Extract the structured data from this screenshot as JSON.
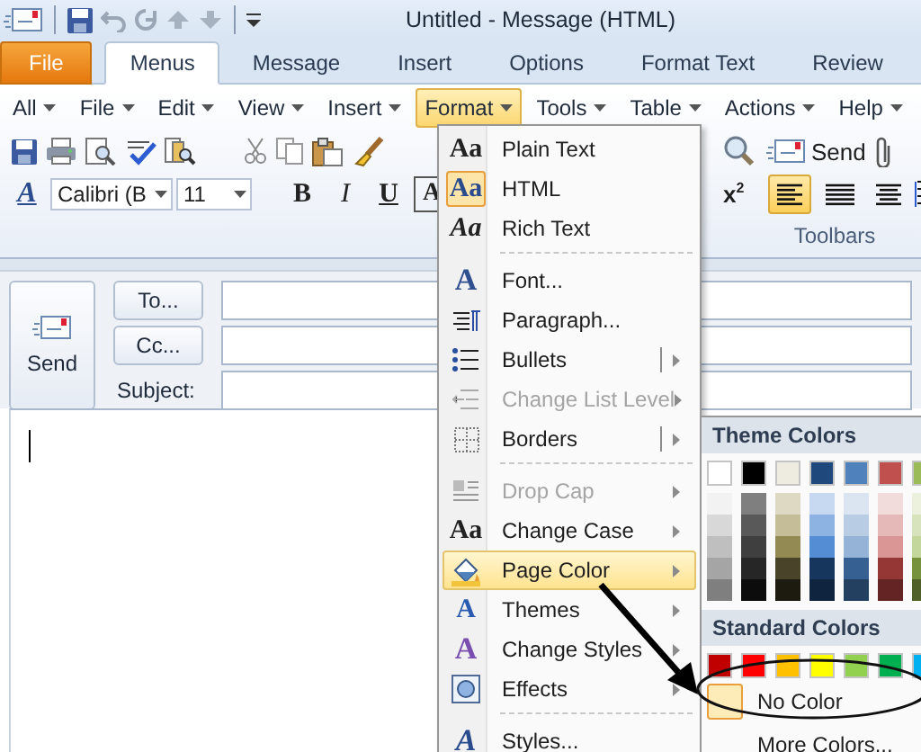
{
  "window": {
    "title": "Untitled - Message (HTML)"
  },
  "ribbon_tabs": [
    {
      "label": "File",
      "kind": "file",
      "selected": false
    },
    {
      "label": "Menus",
      "kind": "tab",
      "selected": true
    },
    {
      "label": "Message",
      "kind": "tab",
      "selected": false
    },
    {
      "label": "Insert",
      "kind": "tab",
      "selected": false
    },
    {
      "label": "Options",
      "kind": "tab",
      "selected": false
    },
    {
      "label": "Format Text",
      "kind": "tab",
      "selected": false
    },
    {
      "label": "Review",
      "kind": "tab",
      "selected": false
    }
  ],
  "menu_bar": [
    {
      "label": "All",
      "selected": false
    },
    {
      "label": "File",
      "selected": false
    },
    {
      "label": "Edit",
      "selected": false
    },
    {
      "label": "View",
      "selected": false
    },
    {
      "label": "Insert",
      "selected": false
    },
    {
      "label": "Format",
      "selected": true
    },
    {
      "label": "Tools",
      "selected": false
    },
    {
      "label": "Table",
      "selected": false
    },
    {
      "label": "Actions",
      "selected": false
    },
    {
      "label": "Help",
      "selected": false
    }
  ],
  "toolbar": {
    "send_label": "Send",
    "styles_glyph": "A",
    "font": "Calibri (B",
    "size": "11",
    "format_buttons": [
      {
        "label": "B",
        "kind": "bold"
      },
      {
        "label": "I",
        "kind": "italic"
      },
      {
        "label": "U",
        "kind": "underline"
      },
      {
        "label": "A",
        "kind": "boxed"
      }
    ],
    "superscript": "x$^{2}$",
    "align_buttons": [
      {
        "kind": "left",
        "selected": true
      },
      {
        "kind": "justify",
        "selected": false
      },
      {
        "kind": "center",
        "selected": false
      }
    ],
    "group_label": "Toolbars"
  },
  "message": {
    "send_label": "Send",
    "to_button": "To...",
    "cc_button": "Cc...",
    "subject_label": "Subject:"
  },
  "format_menu": [
    {
      "kind": "item",
      "glyph": "Aa",
      "label": "Plain Text",
      "selected": false,
      "checked": false,
      "disabled": false,
      "submenu": false,
      "split": false
    },
    {
      "kind": "item",
      "glyph": "Aa",
      "label": "HTML",
      "selected": false,
      "checked": true,
      "disabled": false,
      "submenu": false,
      "split": false
    },
    {
      "kind": "item",
      "glyph": "Aa",
      "label": "Rich Text",
      "selected": false,
      "checked": false,
      "disabled": false,
      "submenu": false,
      "split": false
    },
    {
      "kind": "separator"
    },
    {
      "kind": "item",
      "glyph": "A",
      "label": "Font...",
      "selected": false,
      "checked": false,
      "disabled": false,
      "submenu": false,
      "split": false
    },
    {
      "kind": "item",
      "label": "Paragraph...",
      "selected": false,
      "checked": false,
      "disabled": false,
      "submenu": false,
      "split": false
    },
    {
      "kind": "item",
      "label": "Bullets",
      "selected": false,
      "checked": false,
      "disabled": false,
      "submenu": true,
      "split": true
    },
    {
      "kind": "item",
      "label": "Change List Level",
      "selected": false,
      "checked": false,
      "disabled": true,
      "submenu": true,
      "split": false
    },
    {
      "kind": "item",
      "label": "Borders",
      "selected": false,
      "checked": false,
      "disabled": false,
      "submenu": true,
      "split": true
    },
    {
      "kind": "separator"
    },
    {
      "kind": "item",
      "label": "Drop Cap",
      "selected": false,
      "checked": false,
      "disabled": true,
      "submenu": true,
      "split": false
    },
    {
      "kind": "item",
      "glyph": "Aa",
      "label": "Change Case",
      "selected": false,
      "checked": false,
      "disabled": false,
      "submenu": true,
      "split": false
    },
    {
      "kind": "item",
      "label": "Page Color",
      "selected": true,
      "checked": false,
      "disabled": false,
      "submenu": true,
      "split": false
    },
    {
      "kind": "item",
      "glyph": "A",
      "label": "Themes",
      "selected": false,
      "checked": false,
      "disabled": false,
      "submenu": true,
      "split": false
    },
    {
      "kind": "item",
      "glyph": "A",
      "label": "Change Styles",
      "selected": false,
      "checked": false,
      "disabled": false,
      "submenu": true,
      "split": false
    },
    {
      "kind": "item",
      "label": "Effects",
      "selected": false,
      "checked": false,
      "disabled": false,
      "submenu": true,
      "split": false
    },
    {
      "kind": "separator"
    },
    {
      "kind": "item",
      "glyph": "A",
      "label": "Styles...",
      "selected": false,
      "checked": false,
      "disabled": false,
      "submenu": false,
      "split": false
    }
  ],
  "page_color_menu": {
    "theme_header": "Theme Colors",
    "theme_colors": [
      {
        "color": "#ffffff",
        "shades": [
          {
            "color": "#f2f2f2"
          },
          {
            "color": "#d8d8d8"
          },
          {
            "color": "#bfbfbf"
          },
          {
            "color": "#a5a5a5"
          },
          {
            "color": "#7f7f7f"
          }
        ]
      },
      {
        "color": "#000000",
        "shades": [
          {
            "color": "#7f7f7f"
          },
          {
            "color": "#595959"
          },
          {
            "color": "#3f3f3f"
          },
          {
            "color": "#262626"
          },
          {
            "color": "#0c0c0c"
          }
        ]
      },
      {
        "color": "#eeece1",
        "shades": [
          {
            "color": "#ddd9c3"
          },
          {
            "color": "#c4bd97"
          },
          {
            "color": "#938953"
          },
          {
            "color": "#494429"
          },
          {
            "color": "#1d1b10"
          }
        ]
      },
      {
        "color": "#1f497d",
        "shades": [
          {
            "color": "#c6d9f0"
          },
          {
            "color": "#8db3e2"
          },
          {
            "color": "#548dd4"
          },
          {
            "color": "#17365d"
          },
          {
            "color": "#0f243e"
          }
        ]
      },
      {
        "color": "#4f81bd",
        "shades": [
          {
            "color": "#dbe5f1"
          },
          {
            "color": "#b8cce4"
          },
          {
            "color": "#95b3d7"
          },
          {
            "color": "#366092"
          },
          {
            "color": "#244061"
          }
        ]
      },
      {
        "color": "#c0504d",
        "shades": [
          {
            "color": "#f2dcdb"
          },
          {
            "color": "#e5b9b7"
          },
          {
            "color": "#d99694"
          },
          {
            "color": "#953734"
          },
          {
            "color": "#632423"
          }
        ]
      },
      {
        "color": "#9bbb59",
        "shades": [
          {
            "color": "#ebf1dd"
          },
          {
            "color": "#d7e3bc"
          },
          {
            "color": "#c3d69b"
          },
          {
            "color": "#76923c"
          },
          {
            "color": "#4f6128"
          }
        ]
      }
    ],
    "standard_header": "Standard Colors",
    "standard_colors": [
      {
        "color": "#c00000"
      },
      {
        "color": "#ff0000"
      },
      {
        "color": "#ffc000"
      },
      {
        "color": "#ffff00"
      },
      {
        "color": "#92d050"
      },
      {
        "color": "#00b050"
      },
      {
        "color": "#00b0f0"
      }
    ],
    "items": [
      {
        "label": "No Color",
        "checked": true
      },
      {
        "label": "More Colors...",
        "checked": false
      }
    ]
  }
}
